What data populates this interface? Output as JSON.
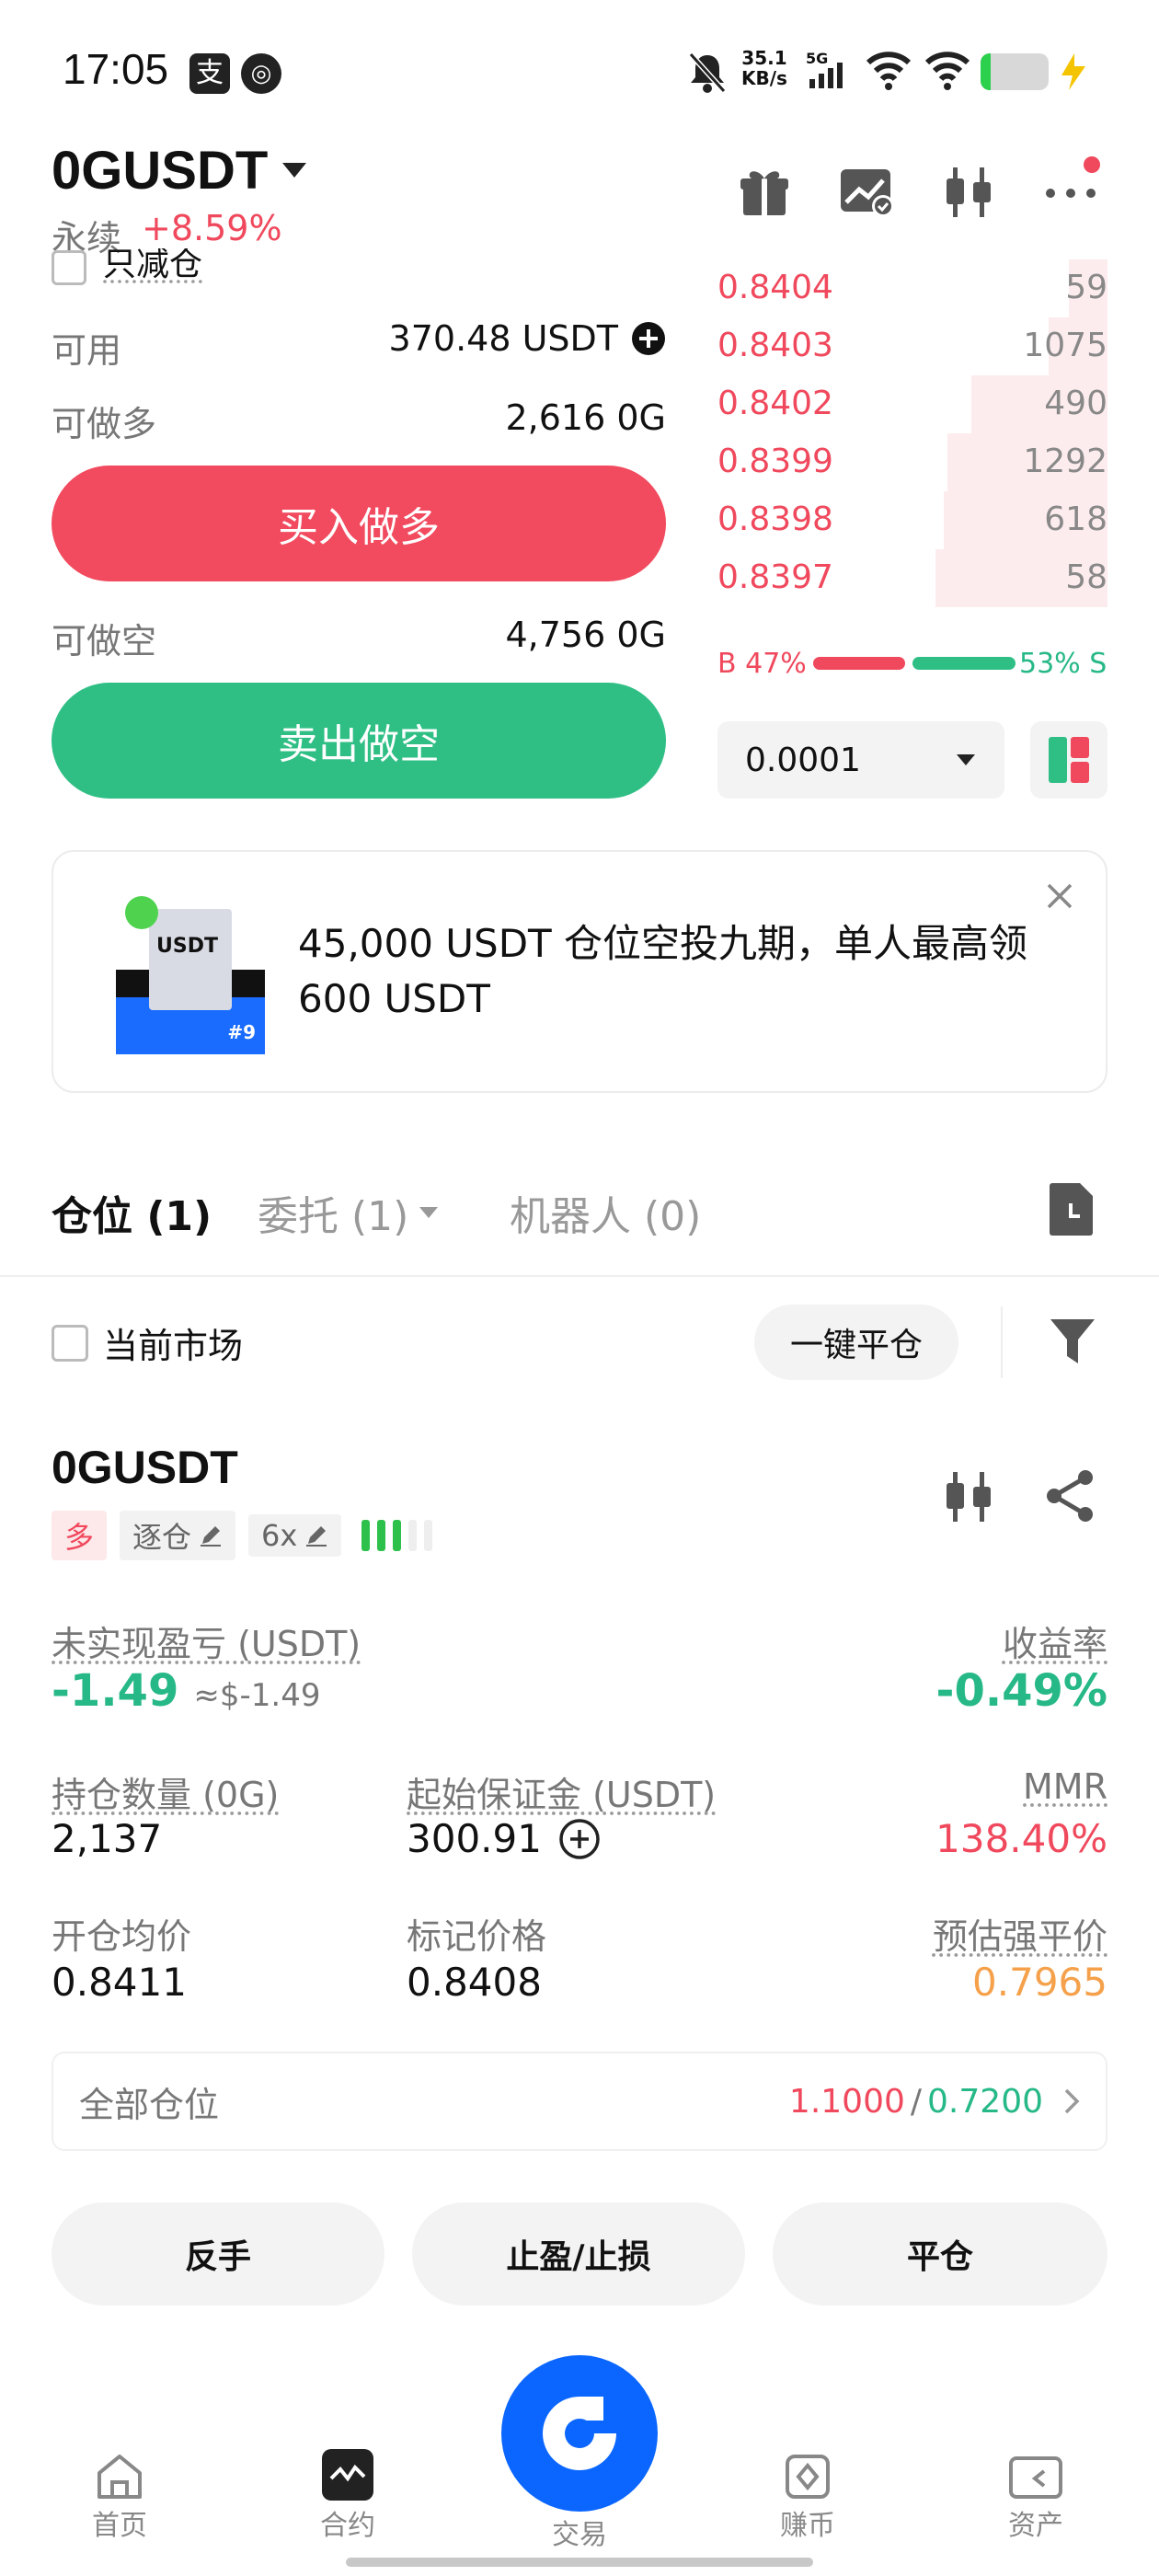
{
  "status_bar": {
    "time": "17:05",
    "net_speed_value": "35.1",
    "net_speed_unit": "KB/s",
    "signal_label": "5G",
    "battery_level": 0.15
  },
  "header": {
    "symbol": "0GUSDT",
    "contract_type": "永续",
    "change": "+8.59%"
  },
  "order_form": {
    "reduce_only": "只减仓",
    "available_label": "可用",
    "available_value": "370.48 USDT",
    "max_long_label": "可做多",
    "max_long_value": "2,616 0G",
    "buy_button": "买入做多",
    "max_short_label": "可做空",
    "max_short_value": "4,756 0G",
    "sell_button": "卖出做空"
  },
  "orderbook": {
    "asks": [
      {
        "price": "0.8404",
        "qty": "59",
        "depth": 0.1
      },
      {
        "price": "0.8403",
        "qty": "1075",
        "depth": 0.15
      },
      {
        "price": "0.8402",
        "qty": "490",
        "depth": 0.35
      },
      {
        "price": "0.8399",
        "qty": "1292",
        "depth": 0.41
      },
      {
        "price": "0.8398",
        "qty": "618",
        "depth": 0.42
      },
      {
        "price": "0.8397",
        "qty": "58",
        "depth": 0.44
      }
    ],
    "buy_ratio_label": "B 47%",
    "sell_ratio_label": "53% S",
    "buy_ratio": 0.47,
    "precision": "0.0001"
  },
  "banner": {
    "text": "45,000 USDT 仓位空投九期，单人最高领 600 USDT",
    "badge_text": "USDT",
    "badge_num": "#9"
  },
  "tabs": {
    "positions": "仓位 (1)",
    "orders": "委托 (1)",
    "bots": "机器人 (0)"
  },
  "filter": {
    "current_market": "当前市场",
    "close_all": "一键平仓"
  },
  "position": {
    "symbol": "0GUSDT",
    "side": "多",
    "margin_mode": "逐仓",
    "leverage": "6x",
    "unrealized_pnl_label": "未实现盈亏 (USDT)",
    "unrealized_pnl": "-1.49",
    "unrealized_pnl_usd": "≈$-1.49",
    "roe_label": "收益率",
    "roe": "-0.49%",
    "size_label": "持仓数量 (0G)",
    "size": "2,137",
    "initial_margin_label": "起始保证金 (USDT)",
    "initial_margin": "300.91",
    "mmr_label": "MMR",
    "mmr": "138.40%",
    "entry_price_label": "开仓均价",
    "entry_price": "0.8411",
    "mark_price_label": "标记价格",
    "mark_price": "0.8408",
    "liq_price_label": "预估强平价",
    "liq_price": "0.7965",
    "tpsl_all_label": "全部仓位",
    "tp_value": "1.1000",
    "separator": "/",
    "sl_value": "0.7200",
    "btn_reverse": "反手",
    "btn_tpsl": "止盈/止损",
    "btn_close": "平仓"
  },
  "bottom_nav": {
    "home": "首页",
    "futures": "合约",
    "trade": "交易",
    "earn": "赚币",
    "assets": "资产"
  },
  "colors": {
    "red": "#f0485c",
    "green": "#26b886",
    "orange": "#f5a14b",
    "blue": "#0a66ff"
  }
}
